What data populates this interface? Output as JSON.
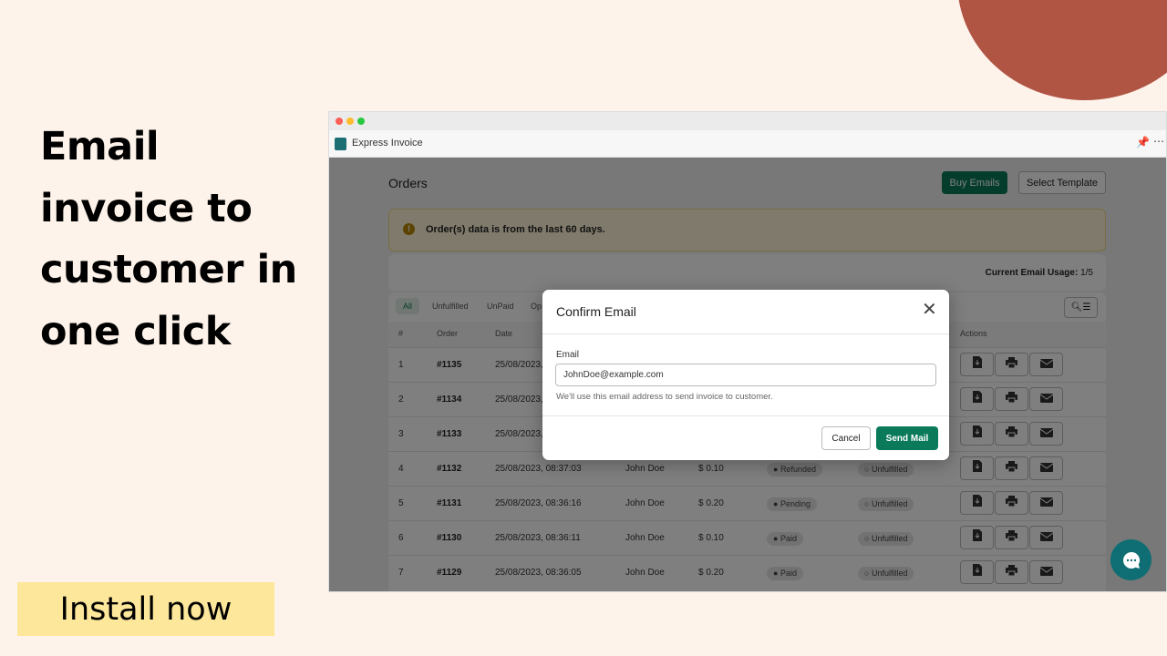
{
  "promo": {
    "headline_lines": [
      "Email",
      "invoice to",
      "customer in",
      "one click"
    ],
    "install_label": "Install now",
    "colors": {
      "background": "#fdf3ea",
      "blob": "#b05444",
      "install_bg": "#fce79a"
    }
  },
  "app": {
    "title": "Express Invoice",
    "page_title": "Orders",
    "buy_emails_label": "Buy Emails",
    "select_template_label": "Select Template",
    "banner_text": "Order(s) data is from the last 60 days.",
    "usage_label": "Current Email Usage:",
    "usage_value": "1/5",
    "tabs": [
      "All",
      "Unfulfilled",
      "UnPaid",
      "Op"
    ],
    "columns": {
      "num": "#",
      "order": "Order",
      "date": "Date",
      "actions": "Actions"
    },
    "rows": [
      {
        "num": "1",
        "order": "#1135",
        "date": "25/08/2023,",
        "customer": "",
        "amount": "",
        "payment": "",
        "fulfillment": ""
      },
      {
        "num": "2",
        "order": "#1134",
        "date": "25/08/2023,",
        "customer": "",
        "amount": "",
        "payment": "",
        "fulfillment": ""
      },
      {
        "num": "3",
        "order": "#1133",
        "date": "25/08/2023,",
        "customer": "",
        "amount": "",
        "payment": "",
        "fulfillment": ""
      },
      {
        "num": "4",
        "order": "#1132",
        "date": "25/08/2023, 08:37:03",
        "customer": "John Doe",
        "amount": "$ 0.10",
        "payment": "Refunded",
        "fulfillment": "Unfulfilled"
      },
      {
        "num": "5",
        "order": "#1131",
        "date": "25/08/2023, 08:36:16",
        "customer": "John Doe",
        "amount": "$ 0.20",
        "payment": "Pending",
        "fulfillment": "Unfulfilled"
      },
      {
        "num": "6",
        "order": "#1130",
        "date": "25/08/2023, 08:36:11",
        "customer": "John Doe",
        "amount": "$ 0.10",
        "payment": "Paid",
        "fulfillment": "Unfulfilled"
      },
      {
        "num": "7",
        "order": "#1129",
        "date": "25/08/2023, 08:36:05",
        "customer": "John Doe",
        "amount": "$ 0.20",
        "payment": "Paid",
        "fulfillment": "Unfulfilled"
      }
    ],
    "colors": {
      "primary": "#0a7a5a",
      "banner": "#fff5d6"
    }
  },
  "modal": {
    "title": "Confirm Email",
    "email_label": "Email",
    "email_value": "JohnDoe@example.com",
    "help_text": "We'll use this email address to send invoice to customer.",
    "cancel_label": "Cancel",
    "send_label": "Send Mail"
  }
}
